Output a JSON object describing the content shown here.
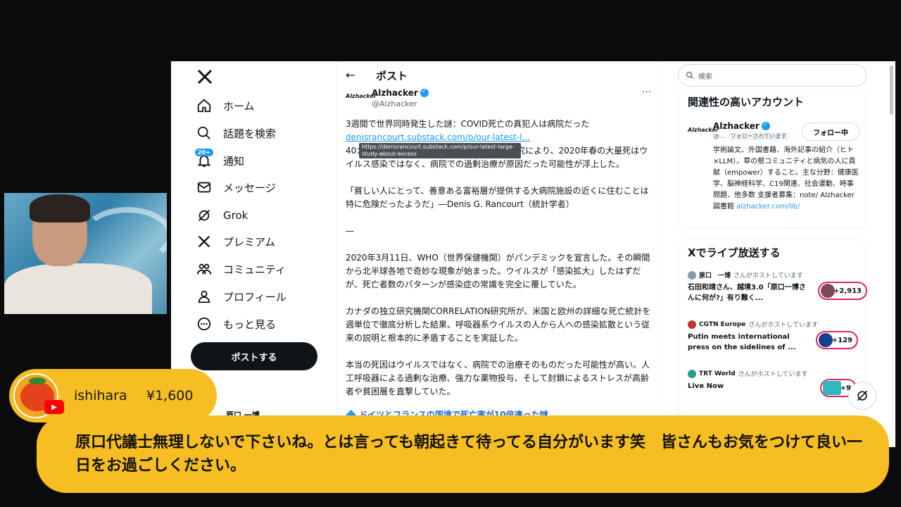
{
  "nav": {
    "items": [
      {
        "label": "ホーム",
        "icon": "home-icon"
      },
      {
        "label": "話題を検索",
        "icon": "search-icon"
      },
      {
        "label": "通知",
        "icon": "bell-icon",
        "badge": "20+"
      },
      {
        "label": "メッセージ",
        "icon": "mail-icon"
      },
      {
        "label": "Grok",
        "icon": "grok-icon"
      },
      {
        "label": "プレミアム",
        "icon": "x-icon"
      },
      {
        "label": "コミュニティ",
        "icon": "community-icon"
      },
      {
        "label": "プロフィール",
        "icon": "person-icon"
      },
      {
        "label": "もっと見る",
        "icon": "more-icon"
      }
    ],
    "post_button": "ポストする",
    "user_partial": "原口 一博"
  },
  "post": {
    "header_title": "ポスト",
    "author_logo": "Alzhacker",
    "author_name": "Alzhacker",
    "author_handle": "@Alzhacker",
    "line1": "3週間で世界同時発生した謎：COVID死亡の真犯人は病院だった",
    "link": "denisrancourt.substack.com/p/our-latest-l...",
    "tooltip": "https://denisrancourt.substack.com/p/our-latest-large-study-about-excess",
    "line2": "40カ国の超過死亡データを詳細に分析した研究により、2020年春の大量死はウイルス感染ではなく、病院での過剰治療が原因だった可能性が浮上した。",
    "quote": "「貧しい人にとって、善意ある富裕層が提供する大病院施設の近くに住むことは特に危険だったようだ」―Denis G. Rancourt（統計学者）",
    "divider": "—",
    "para1": "2020年3月11日、WHO（世界保健機関）がパンデミックを宣言した。その瞬間から北半球各地で奇妙な現象が始まった。ウイルスが「感染拡大」したはずだが、死亡者数のパターンが感染症の常識を完全に覆していた。",
    "para2": "カナダの独立研究機関CORRELATION研究所が、米国と欧州の詳細な死亡統計を週単位で徹底分析した結果、呼吸器系ウイルスの人から人への感染拡散という従来の説明と根本的に矛盾することを実証した。",
    "para3": "本当の死因はウイルスではなく、病院での治療そのものだった可能性が高い。人工呼吸器による過剰な治療、強力な薬物投与、そして封鎖によるストレスが高齢者や貧困層を直撃していた。",
    "section_head": "🔷 ドイツとフランスの国境で死亡率が10倍違った謎"
  },
  "right": {
    "search_placeholder": "検索",
    "related_title": "関連性の高いアカウント",
    "account": {
      "logo": "Alzhacker",
      "name": "Alzhacker",
      "handle": "@...",
      "follows_you": "フォローされています",
      "follow_button": "フォロー中",
      "bio": "学術論文、外国書籍、海外記事の紹介（ヒト×LLM）。草の根コミュニティと病気の人に貢献（empower）すること。主な分野：健康医学、脳神経科学、C19関連、社会運動、時事問題、他多数 支援者募集：note/ Alzhacker図書館",
      "bio_link": "alzhacker.com/lib/"
    },
    "live_title": "Xでライブ放送する",
    "live": [
      {
        "host": "原口　一博",
        "suffix": "さんがホストしています",
        "title": "石田和靖さん、越境3.0「原口一博さんに何が?」有り難く...",
        "count": "+2,913"
      },
      {
        "host": "CGTN Europe",
        "suffix": "さんがホストしています",
        "title": "Putin meets international press on the sidelines of ...",
        "count": "+129"
      },
      {
        "host": "TRT World",
        "suffix": "さんがホストしています",
        "title": "Live Now",
        "count": "+9"
      }
    ]
  },
  "superchat": {
    "name": "ishihara",
    "amount": "¥1,600",
    "message": "原口代議士無理しないで下さいね。とは言っても朝起きて待ってる自分がいます笑　皆さんもお気をつけて良い一日をお過ごしください。"
  },
  "colors": {
    "accent": "#1d9bf0",
    "superchat": "#f6be23",
    "live_border": "#e0245e"
  }
}
